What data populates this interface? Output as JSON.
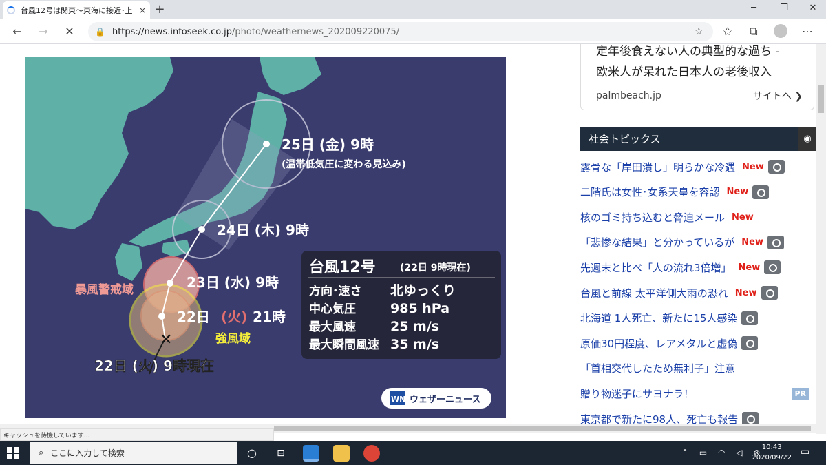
{
  "browser": {
    "tab_title": "台風12号は関東〜東海に接近･上",
    "tab_close": "×",
    "new_tab": "+",
    "url_host": "https://news.infoseek.co.jp",
    "url_path": "/photo/weathernews_202009220075/",
    "status_text": "キャッシュを待機しています..."
  },
  "map": {
    "labels": {
      "p25": "25日 (金) 9時",
      "p25_sub": "(温帯低気圧に変わる見込み)",
      "p24": "24日 (木) 9時",
      "p23": "23日 (水) 9時",
      "p22_pre": "22日",
      "p22_day": "(火)",
      "p22_time": "21時",
      "now": "22日 (火) 9時現在",
      "storm_zone": "暴風警戒域",
      "strong_zone": "強風域"
    },
    "info": {
      "title": "台風12号",
      "as_of": "(22日 9時現在)",
      "rows": [
        {
          "k": "方向･速さ",
          "v": "北ゆっくり"
        },
        {
          "k": "中心気圧",
          "v": "985 hPa"
        },
        {
          "k": "最大風速",
          "v": "25 m/s"
        },
        {
          "k": "最大瞬間風速",
          "v": "35 m/s"
        }
      ]
    },
    "logo_mark": "WN",
    "logo_text": "ウェザーニュース"
  },
  "ad": {
    "line1": "定年後食えない人の典型的な過ち -",
    "line2": "欧米人が呆れた日本人の老後収入",
    "domain": "palmbeach.jp",
    "cta": "サイトへ ❯"
  },
  "topics": {
    "header": "社会トピックス",
    "new_label": "New",
    "pr_label": "PR",
    "items": [
      {
        "text": "露骨な「岸田潰し」明らかな冷遇",
        "new": true,
        "cam": true
      },
      {
        "text": "二階氏は女性･女系天皇を容認",
        "new": true,
        "cam": true
      },
      {
        "text": "核のゴミ持ち込むと脅迫メール",
        "new": true,
        "cam": false
      },
      {
        "text": "「悲惨な結果」と分かっているが",
        "new": true,
        "cam": true
      },
      {
        "text": "先週末と比べ「人の流れ3倍増」",
        "new": true,
        "cam": true
      },
      {
        "text": "台風と前線 太平洋側大雨の恐れ",
        "new": true,
        "cam": true
      },
      {
        "text": "北海道 1人死亡、新たに15人感染",
        "new": false,
        "cam": true
      },
      {
        "text": "原価30円程度、レアメタルと虚偽",
        "new": false,
        "cam": true
      },
      {
        "text": "「首相交代したため無利子」注意",
        "new": false,
        "cam": false
      },
      {
        "text": "贈り物迷子にサヨナラ！",
        "new": false,
        "cam": false,
        "pr": true
      },
      {
        "text": "東京都で新たに98人、死亡も報告",
        "new": false,
        "cam": true
      }
    ]
  },
  "taskbar": {
    "search_placeholder": "ここに入力して検索",
    "time": "10:43",
    "date": "2020/09/22"
  }
}
